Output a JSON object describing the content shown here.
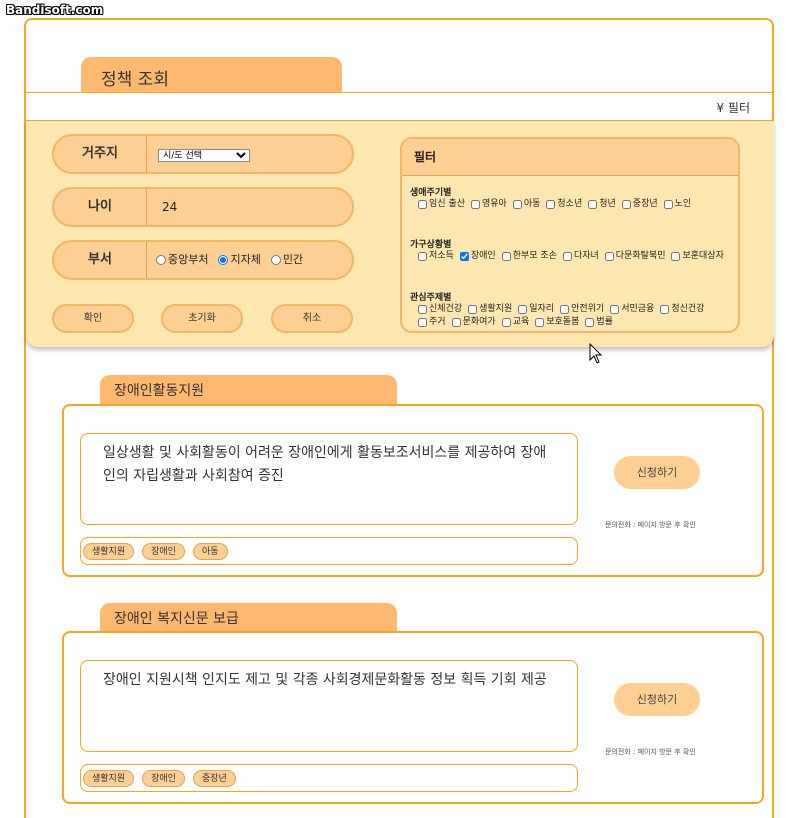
{
  "watermark": "Bandisoft.com",
  "page_title": "정책 조회",
  "filter_toggle": "¥ 필터",
  "form": {
    "region_label": "거주지",
    "region_value": "시/도 선택",
    "age_label": "나이",
    "age_value": "24",
    "dept_label": "부서",
    "dept_options": [
      "중앙부처",
      "지자체",
      "민간"
    ],
    "dept_selected": "지자체"
  },
  "buttons": {
    "confirm": "확인",
    "reset": "초기화",
    "cancel": "취소"
  },
  "filter_panel": {
    "title": "필터",
    "sections": [
      {
        "title": "생애주기별",
        "options": [
          {
            "label": "임신 출산",
            "checked": false
          },
          {
            "label": "영유아",
            "checked": false
          },
          {
            "label": "아동",
            "checked": false
          },
          {
            "label": "청소년",
            "checked": false
          },
          {
            "label": "청년",
            "checked": false
          },
          {
            "label": "중장년",
            "checked": false
          },
          {
            "label": "노인",
            "checked": false
          }
        ]
      },
      {
        "title": "가구상황별",
        "options": [
          {
            "label": "저소득",
            "checked": false
          },
          {
            "label": "장애인",
            "checked": true
          },
          {
            "label": "한부모 조손",
            "checked": false
          },
          {
            "label": "다자녀",
            "checked": false
          },
          {
            "label": "다문화탈북민",
            "checked": false
          },
          {
            "label": "보훈대상자",
            "checked": false
          }
        ]
      },
      {
        "title": "관심주제별",
        "options": [
          {
            "label": "신체건강",
            "checked": false
          },
          {
            "label": "생활지원",
            "checked": false
          },
          {
            "label": "일자리",
            "checked": false
          },
          {
            "label": "안전위기",
            "checked": false
          },
          {
            "label": "서민금융",
            "checked": false
          },
          {
            "label": "정신건강",
            "checked": false
          },
          {
            "label": "주거",
            "checked": false
          },
          {
            "label": "문화여가",
            "checked": false
          },
          {
            "label": "교육",
            "checked": false
          },
          {
            "label": "보호돌봄",
            "checked": false
          },
          {
            "label": "법률",
            "checked": false
          }
        ]
      }
    ]
  },
  "results": [
    {
      "title": "장애인활동지원",
      "description": "일상생활 및 사회활동이 어려운 장애인에게 활동보조서비스를 제공하여 장애인의 자립생활과 사회참여 증진",
      "tags": [
        "생활지원",
        "장애인",
        "아동"
      ],
      "apply_label": "신청하기",
      "contact": "문의전화 : 페이지 방문 후 확인"
    },
    {
      "title": "장애인 복지신문 보급",
      "description": "장애인 지원시책 인지도 제고 및 각종 사회경제문화활동 정보 획득 기회 제공",
      "tags": [
        "생활지원",
        "장애인",
        "중장년"
      ],
      "apply_label": "신청하기",
      "contact": "문의전화 : 페이지 방문 후 확인"
    }
  ]
}
